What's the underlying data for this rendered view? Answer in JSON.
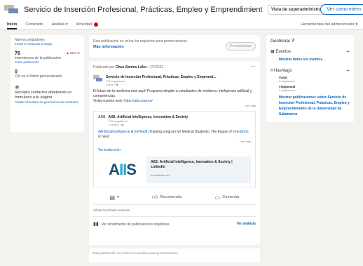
{
  "header": {
    "title": "Servicio de Inserción Profesional, Prácticas, Empleo y Emprendimiento de la Univ...",
    "admin_view": "Vista de superadministrador",
    "view_as": "Ver como miem"
  },
  "tabs": [
    {
      "label": "Inicio"
    },
    {
      "label": "Contenido"
    },
    {
      "label": "Análisis"
    },
    {
      "label": "Actividad"
    }
  ],
  "admin_tools": "Herramientas del administrador",
  "left": {
    "new_followers": "Nuevos seguidores",
    "invite": "Invitar a contactos a seguir",
    "impressions_value": "76",
    "impressions_change": "▲ 28,2 %",
    "impressions_label": "Impresiones de la publicación",
    "create_post": "Crear publicación",
    "clicks_value": "0",
    "clicks_label": "Clic en el botón personalizado",
    "collect_text": "Recopila contactos añadiendo un formulario a tu página",
    "add_form": "Añade formulario de generación de contactos"
  },
  "promo": {
    "text": "Esta publicación no reúne los requisitos para promocionarse.",
    "more": "Más información",
    "button": "Promocionar"
  },
  "post": {
    "published_by": "Publicado por",
    "author": "Chus Santos Lobo",
    "date": "7/7/2022",
    "org_name": "Servicio de Inserción Profesional, Prácticas, Empleo y Emprendi...",
    "org_followers": "171 seguidores",
    "org_time": "Ahora",
    "text": "El futuro de la medicina está aquí! Programa dirigido a estudiantes de medicina. Inteligencia artificial y competencias.",
    "visit": "Visita nuestra web:",
    "url": "https://aiis.usal.es/",
    "see_more": "...ver más",
    "shared_name": "AIIS: Artificial Intelligence, Innovation & Society",
    "shared_mini": "AIIS",
    "shared_followers": "103 seguidores",
    "shared_time": "2 meses",
    "hashtag1": "#ArtificialIntelligence",
    "amp": " & ",
    "hashtag2": "#eHealth",
    "shared_text": " Training program for Medical Students. The Future of ",
    "hashtag3": "#medicine",
    "shared_tail": " is here!",
    "shared_see_more": "...ver más",
    "translate": "Ver traducción",
    "link_logo_main": "A",
    "link_logo_ii": "II",
    "link_logo_s": "S",
    "link_title": "AIIS: Artificial Intelligence, Innovation & Society | LinkedIn",
    "link_domain": "es.linkedin.com",
    "recommend": "Recomendar",
    "comment": "Comentar",
    "first_reaction": "Añade la primera reacción",
    "organic": "Ver rendimiento de publicaciones orgánicas",
    "analysis": "Ver análisis"
  },
  "bottom": {
    "text": "Esta publicación no reúne los requisitos para promocionarse."
  },
  "right": {
    "title": "Gestionar",
    "events": "Eventos",
    "show_events": "Mostrar todos los eventos",
    "hashtags": "Hashtags",
    "tag1": "#usal",
    "tag1_f": "0 seguidores",
    "tag2": "#sippeusal",
    "tag2_f": "0 seguidores",
    "manage_posts": "Mostrar publicaciones sobre Servicio de Inserción Profesional, Prácticas, Empleo y Emprendimiento de la Universidad de Salamanca"
  }
}
